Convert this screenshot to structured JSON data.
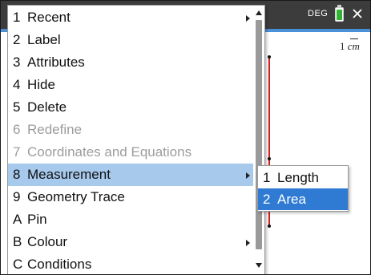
{
  "status_bar": {
    "angle_mode": "DEG",
    "battery_icon": "battery-full-icon",
    "close_icon": "close-icon"
  },
  "canvas": {
    "scale_value": "1",
    "scale_unit": "cm",
    "segment_color": "#d62020"
  },
  "context_menu": {
    "items": [
      {
        "key": "1",
        "label": "Recent",
        "submenu": true,
        "enabled": true,
        "selected": false
      },
      {
        "key": "2",
        "label": "Label",
        "submenu": false,
        "enabled": true,
        "selected": false
      },
      {
        "key": "3",
        "label": "Attributes",
        "submenu": false,
        "enabled": true,
        "selected": false
      },
      {
        "key": "4",
        "label": "Hide",
        "submenu": false,
        "enabled": true,
        "selected": false
      },
      {
        "key": "5",
        "label": "Delete",
        "submenu": false,
        "enabled": true,
        "selected": false
      },
      {
        "key": "6",
        "label": "Redefine",
        "submenu": false,
        "enabled": false,
        "selected": false
      },
      {
        "key": "7",
        "label": "Coordinates and Equations",
        "submenu": false,
        "enabled": false,
        "selected": false
      },
      {
        "key": "8",
        "label": "Measurement",
        "submenu": true,
        "enabled": true,
        "selected": true
      },
      {
        "key": "9",
        "label": "Geometry Trace",
        "submenu": false,
        "enabled": true,
        "selected": false
      },
      {
        "key": "A",
        "label": "Pin",
        "submenu": false,
        "enabled": true,
        "selected": false
      },
      {
        "key": "B",
        "label": "Colour",
        "submenu": true,
        "enabled": true,
        "selected": false
      },
      {
        "key": "C",
        "label": "Conditions",
        "submenu": false,
        "enabled": true,
        "selected": false
      }
    ]
  },
  "submenu": {
    "items": [
      {
        "key": "1",
        "label": "Length",
        "selected": false
      },
      {
        "key": "2",
        "label": "Area",
        "selected": true
      }
    ]
  },
  "colors": {
    "status_bar_bg": "#3c3c3c",
    "menu_highlight": "#a6c9ec",
    "submenu_highlight": "#2f7bd3",
    "disabled_text": "#9c9c9c"
  }
}
